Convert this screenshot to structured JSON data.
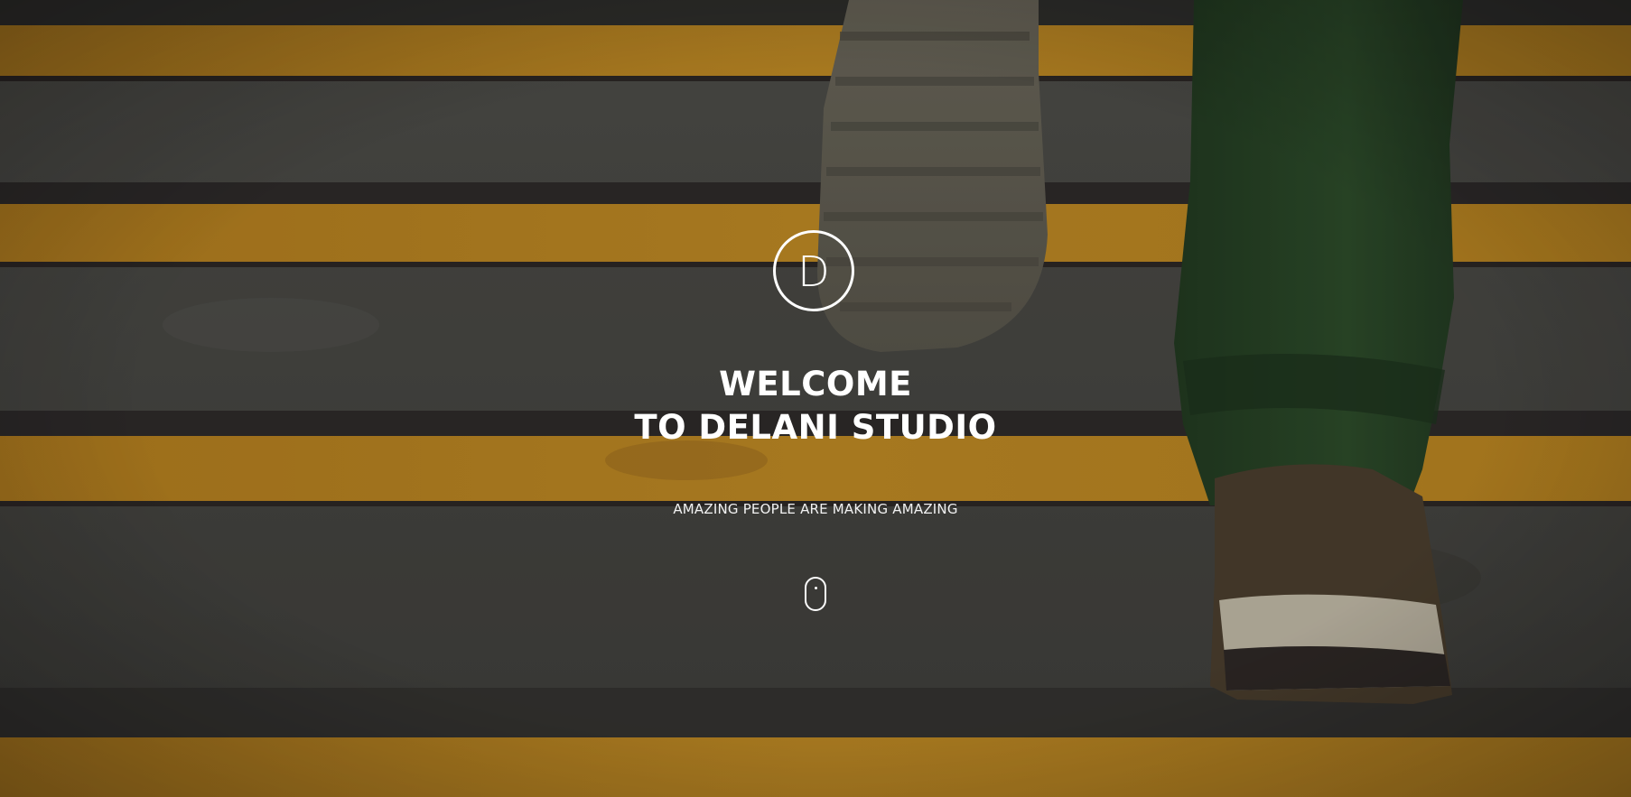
{
  "hero": {
    "logo_letter": "D",
    "title_line1": "WELCOME",
    "title_line2": "TO DELANI STUDIO",
    "tagline": "AMAZING PEOPLE ARE MAKING AMAZING",
    "scroll_icon": "mouse-scroll-icon",
    "background": "photo of a person climbing grey concrete stairs with yellow-orange edge stripes"
  },
  "colors": {
    "text": "#ffffff",
    "stripe": "#c9921e",
    "concrete": "#4a4b45"
  }
}
